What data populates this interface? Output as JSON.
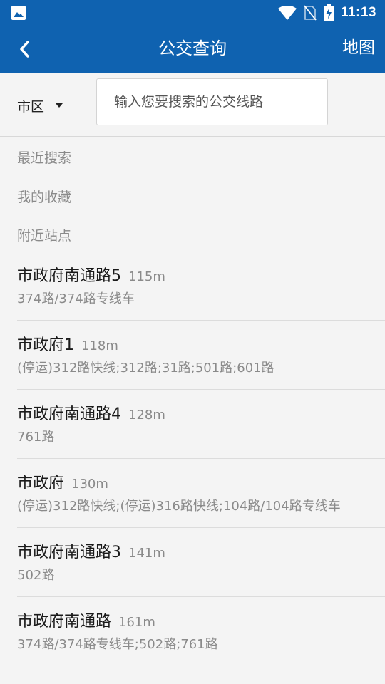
{
  "status_bar": {
    "time": "11:13",
    "icons": [
      "gallery-icon",
      "wifi-icon",
      "no-sim-icon",
      "battery-charging-icon"
    ]
  },
  "app_bar": {
    "title": "公交查询",
    "map_label": "地图",
    "back_icon": "chevron-left-icon",
    "color": "#0f62b0"
  },
  "search": {
    "city": "市区",
    "placeholder": "输入您要搜索的公交线路"
  },
  "sections": {
    "recent": "最近搜索",
    "favorites": "我的收藏",
    "nearby": "附近站点"
  },
  "stations": [
    {
      "name": "市政府南通路5",
      "distance": "115m",
      "routes": "374路/374路专线车"
    },
    {
      "name": "市政府1",
      "distance": "118m",
      "routes": "(停运)312路快线;312路;31路;501路;601路"
    },
    {
      "name": "市政府南通路4",
      "distance": "128m",
      "routes": "761路"
    },
    {
      "name": "市政府",
      "distance": "130m",
      "routes": "(停运)312路快线;(停运)316路快线;104路/104路专线车"
    },
    {
      "name": "市政府南通路3",
      "distance": "141m",
      "routes": "502路"
    },
    {
      "name": "市政府南通路",
      "distance": "161m",
      "routes": "374路/374路专线车;502路;761路"
    }
  ]
}
